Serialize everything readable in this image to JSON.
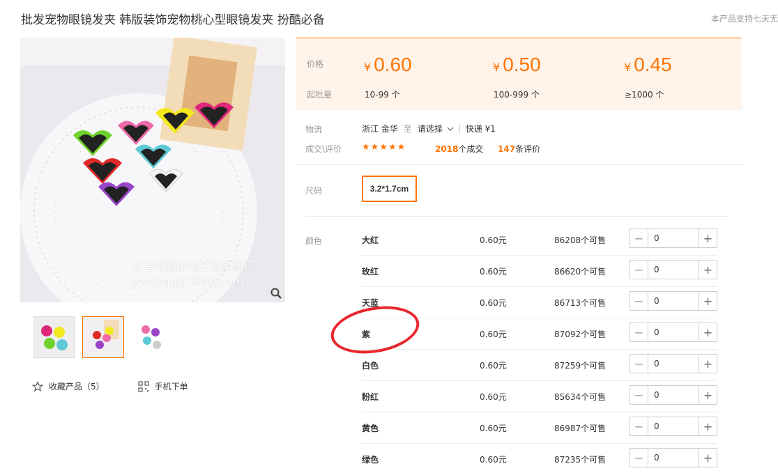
{
  "title": "批发宠物眼镜发夹 韩版装饰宠物桃心型眼镜发夹 扮酷必备",
  "promise": "本产品支持七天无",
  "watermark": {
    "line1": "义乌市酷玩电子商务商行",
    "line2": "ywdxsppj.1688.com"
  },
  "actions": {
    "favorite": "收藏产品（5）",
    "mobile": "手机下单"
  },
  "price_box": {
    "price_label": "价格",
    "min_label": "起批量",
    "currency": "¥",
    "tiers": [
      {
        "price": "0.60",
        "range": "10-99 个"
      },
      {
        "price": "0.50",
        "range": "100-999 个"
      },
      {
        "price": "0.45",
        "range": "≥1000 个"
      }
    ]
  },
  "logistics": {
    "label": "物流",
    "from": "浙江 金华",
    "to_word": "至",
    "select": "请选择",
    "express": "快递 ¥1"
  },
  "deal": {
    "label": "成交\\评价",
    "stars": "★★★★★",
    "deals_count": "2018",
    "deals_suffix": "个成交",
    "review_count": "147",
    "review_suffix": "条评价"
  },
  "size": {
    "label": "尺码",
    "value": "3.2*1.7cm"
  },
  "color": {
    "label": "颜色",
    "rows": [
      {
        "name": "大红",
        "price": "0.60元",
        "stock": "86208个可售",
        "qty": "0"
      },
      {
        "name": "玫红",
        "price": "0.60元",
        "stock": "86620个可售",
        "qty": "0"
      },
      {
        "name": "天蓝",
        "price": "0.60元",
        "stock": "86713个可售",
        "qty": "0"
      },
      {
        "name": "紫",
        "price": "0.60元",
        "stock": "87092个可售",
        "qty": "0"
      },
      {
        "name": "白色",
        "price": "0.60元",
        "stock": "87259个可售",
        "qty": "0"
      },
      {
        "name": "粉红",
        "price": "0.60元",
        "stock": "85634个可售",
        "qty": "0"
      },
      {
        "name": "黄色",
        "price": "0.60元",
        "stock": "86987个可售",
        "qty": "0"
      },
      {
        "name": "绿色",
        "price": "0.60元",
        "stock": "87235个可售",
        "qty": "0"
      }
    ]
  },
  "colors": {
    "accent": "#ff7300",
    "price_bg": "#fff3ea",
    "annotation": "#e8262c"
  }
}
